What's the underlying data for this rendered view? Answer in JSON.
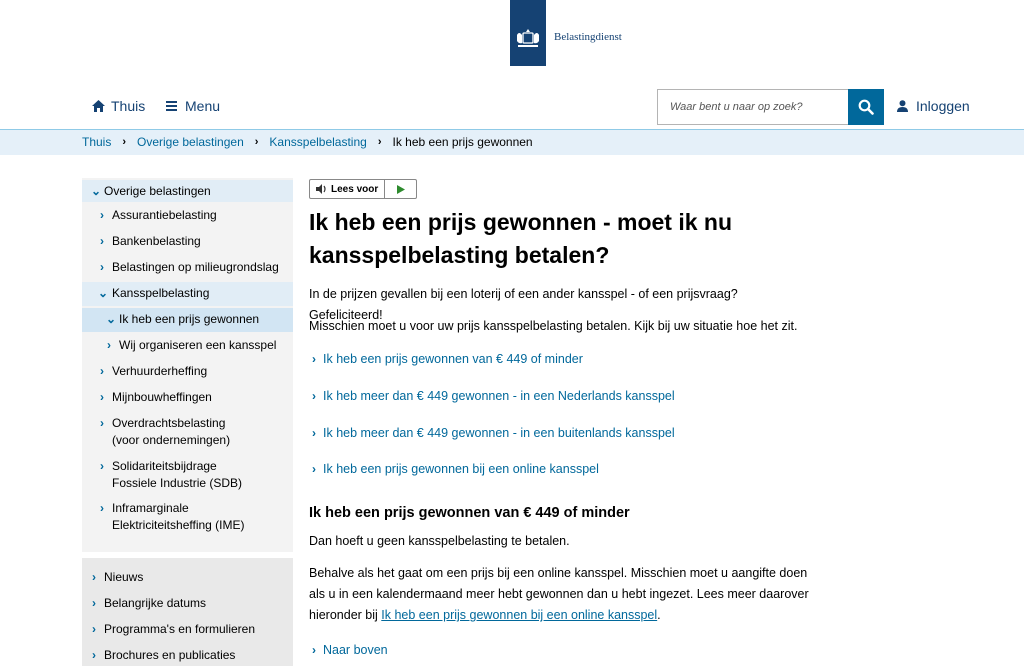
{
  "header": {
    "logo_text": "Belastingdienst",
    "brand_color": "#154273",
    "link_color": "#01689b"
  },
  "nav": {
    "home_label": "Thuis",
    "menu_label": "Menu",
    "search_placeholder": "Waar bent u naar op zoek?",
    "login_label": "Inloggen"
  },
  "breadcrumb": {
    "items": [
      "Thuis",
      "Overige belastingen",
      "Kansspelbelasting"
    ],
    "current": "Ik heb een prijs gewonnen"
  },
  "sidebar": {
    "items": [
      {
        "label": "Overige belastingen",
        "expanded": true
      },
      {
        "label": "Assurantiebelasting"
      },
      {
        "label": "Bankenbelasting"
      },
      {
        "label": "Belastingen op milieugrondslag"
      },
      {
        "label": "Kansspelbelasting",
        "expanded": true
      },
      {
        "label": "Ik heb een prijs gewonnen",
        "expanded": true,
        "active": true
      },
      {
        "label": "Wij organiseren een kansspel"
      },
      {
        "label": "Verhuurderheffing"
      },
      {
        "label": "Mijnbouwheffingen"
      },
      {
        "label": "Overdrachtsbelasting",
        "label2": "(voor ondernemingen)"
      },
      {
        "label": "Solidariteitsbijdrage",
        "label2": "Fossiele Industrie (SDB)"
      },
      {
        "label": "Inframarginale",
        "label2": "Elektriciteitsheffing (IME)"
      }
    ],
    "secondary": [
      "Nieuws",
      "Belangrijke datums",
      "Programma's en formulieren",
      "Brochures en publicaties"
    ]
  },
  "main": {
    "read_aloud": "Lees voor",
    "title": "Ik heb een prijs gewonnen - moet ik nu kansspelbelasting betalen?",
    "intro1": "In de prijzen gevallen bij een loterij of een ander kansspel - of een prijsvraag? Gefeliciteerd!",
    "intro2": "Misschien moet u voor uw prijs kansspelbelasting betalen. Kijk bij uw situatie hoe het zit.",
    "links": [
      "Ik heb een prijs gewonnen van € 449 of minder",
      "Ik heb meer dan € 449 gewonnen - in een Nederlands kansspel",
      "Ik heb meer dan € 449 gewonnen - in een buitenlands kansspel",
      "Ik heb een prijs gewonnen bij een online kansspel"
    ],
    "section_title": "Ik heb een prijs gewonnen van € 449 of minder",
    "section_p1": "Dan hoeft u geen kansspelbelasting te betalen.",
    "section_p2": "Behalve als het gaat om een prijs bij een online kansspel. Misschien moet u aangifte doen als u in een kalendermaand meer hebt gewonnen dan u hebt ingezet. Lees meer daarover hieronder bij",
    "section_p2_link": "Ik heb een prijs gewonnen bij een online kansspel",
    "section_p2_end": ".",
    "back_to_top": "Naar boven"
  }
}
